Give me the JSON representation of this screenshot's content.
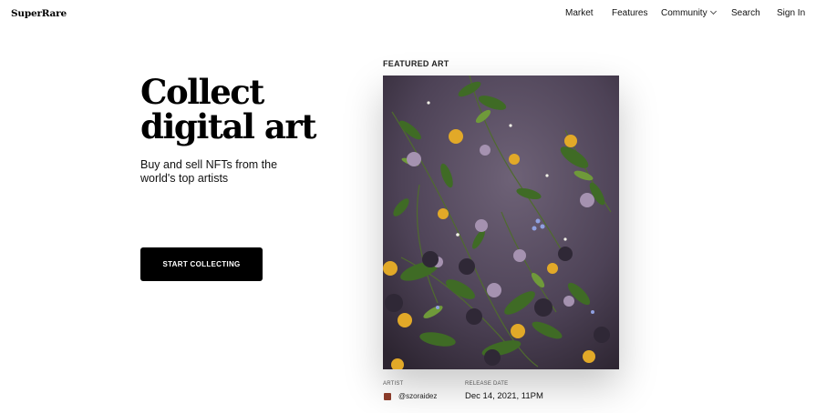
{
  "nav": {
    "logo": "SuperRare",
    "market": "Market",
    "features": "Features",
    "community": "Community",
    "search": "Search",
    "sign_in": "Sign In"
  },
  "hero": {
    "title_line1": "Collect",
    "title_line2": "digital art",
    "subtitle": "Buy and sell NFTs from the world's top artists",
    "cta": "START COLLECTING"
  },
  "featured": {
    "label": "FEATURED ART",
    "artist_label": "ARTIST",
    "artist_name": "@szoraidez",
    "release_label": "RELEASE DATE",
    "release_date": "Dec 14, 2021, 11PM"
  },
  "colors": {
    "background": "#ffffff",
    "cta_background": "#000000",
    "artwork_background": "#4a3f52"
  }
}
